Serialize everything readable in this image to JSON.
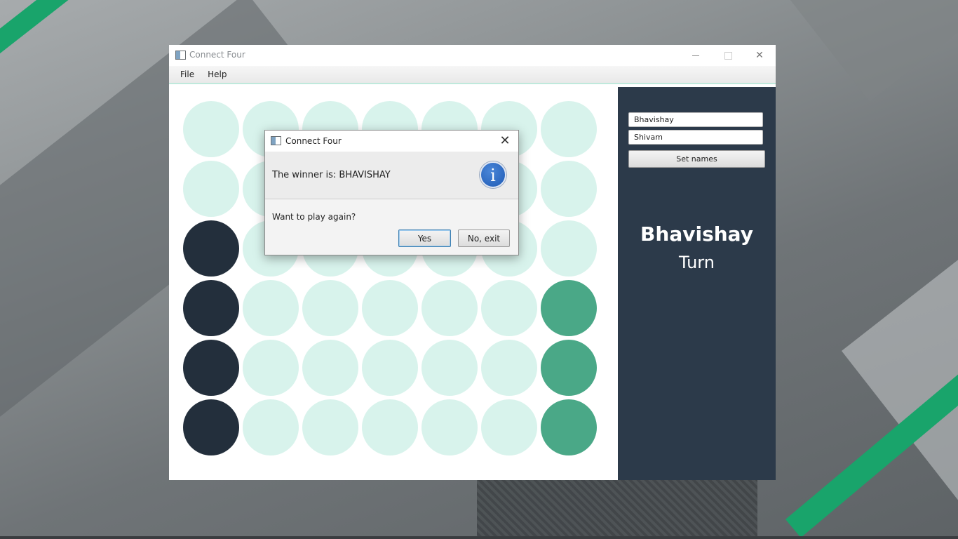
{
  "window": {
    "title": "Connect Four",
    "menu": [
      "File",
      "Help"
    ]
  },
  "board": {
    "columns": 7,
    "rows": 6,
    "cells": [
      [
        "empty",
        "empty",
        "empty",
        "empty",
        "empty",
        "empty",
        "empty"
      ],
      [
        "empty",
        "empty",
        "empty",
        "empty",
        "empty",
        "empty",
        "empty"
      ],
      [
        "p1",
        "empty",
        "empty",
        "empty",
        "empty",
        "empty",
        "empty"
      ],
      [
        "p1",
        "empty",
        "empty",
        "empty",
        "empty",
        "empty",
        "p2"
      ],
      [
        "p1",
        "empty",
        "empty",
        "empty",
        "empty",
        "empty",
        "p2"
      ],
      [
        "p1",
        "empty",
        "empty",
        "empty",
        "empty",
        "empty",
        "p2"
      ]
    ],
    "colors": {
      "empty": "#d8f3ec",
      "p1": "#232f3c",
      "p2": "#4aa887"
    }
  },
  "panel": {
    "player1_name": "Bhavishay",
    "player2_name": "Shivam",
    "set_names_label": "Set names",
    "turn_player": "Bhavishay",
    "turn_label": "Turn"
  },
  "dialog": {
    "title": "Connect Four",
    "header": "The winner is: BHAVISHAY",
    "icon": "info-icon",
    "content": "Want to play again?",
    "yes_label": "Yes",
    "no_label": "No, exit",
    "close_glyph": "✕"
  }
}
